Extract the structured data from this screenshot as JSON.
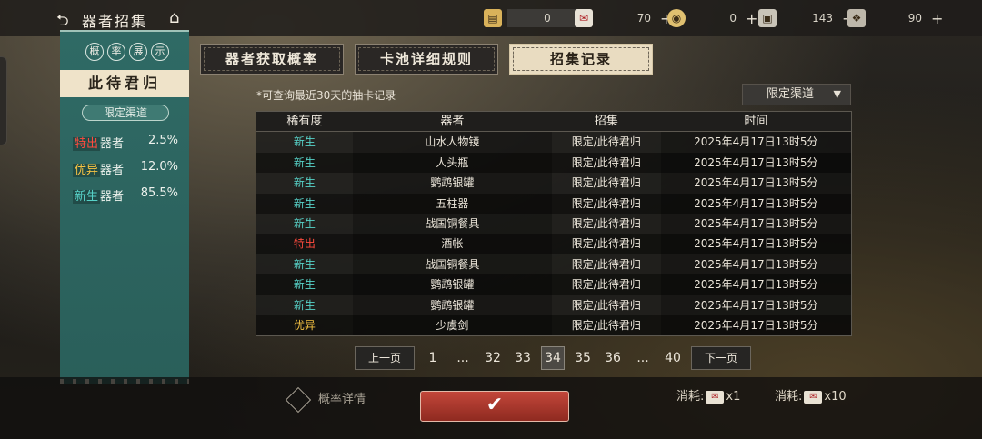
{
  "header": {
    "back_icon": "back-arrow-icon",
    "title": "器者招集",
    "home_icon": "home-icon"
  },
  "resources": [
    {
      "icon": "scroll-icon",
      "value": "0",
      "color": "#d9b25a"
    },
    {
      "icon": "envelope-icon",
      "value": "70",
      "color": "#e8e2d6"
    },
    {
      "icon": "coin-icon",
      "value": "0",
      "color": "#e0c070"
    },
    {
      "icon": "token-icon",
      "value": "143",
      "color": "#c9c4b8"
    },
    {
      "icon": "pattern-icon",
      "value": "90",
      "color": "#bdb7aa"
    }
  ],
  "prob_panel": {
    "tags": [
      "概",
      "率",
      "展",
      "示"
    ],
    "pool_name": "此待君归",
    "channel": "限定渠道",
    "rates": [
      {
        "rarity": "特出",
        "label": "器者",
        "value": "2.5%"
      },
      {
        "rarity": "优异",
        "label": "器者",
        "value": "12.0%"
      },
      {
        "rarity": "新生",
        "label": "器者",
        "value": "85.5%"
      }
    ]
  },
  "tabs": [
    {
      "label": "器者获取概率",
      "active": false
    },
    {
      "label": "卡池详细规则",
      "active": false
    },
    {
      "label": "招集记录",
      "active": true
    }
  ],
  "notice": "*可查询最近30天的抽卡记录",
  "channel_filter": "限定渠道",
  "table": {
    "headers": [
      "稀有度",
      "器者",
      "招集",
      "时间"
    ],
    "rows": [
      {
        "rarity": "新生",
        "name": "山水人物镜",
        "pool": "限定/此待君归",
        "time": "2025年4月17日13时5分"
      },
      {
        "rarity": "新生",
        "name": "人头瓶",
        "pool": "限定/此待君归",
        "time": "2025年4月17日13时5分"
      },
      {
        "rarity": "新生",
        "name": "鹦鹉银罐",
        "pool": "限定/此待君归",
        "time": "2025年4月17日13时5分"
      },
      {
        "rarity": "新生",
        "name": "五柱器",
        "pool": "限定/此待君归",
        "time": "2025年4月17日13时5分"
      },
      {
        "rarity": "新生",
        "name": "战国铜餐具",
        "pool": "限定/此待君归",
        "time": "2025年4月17日13时5分"
      },
      {
        "rarity": "特出",
        "name": "酒帐",
        "pool": "限定/此待君归",
        "time": "2025年4月17日13时5分"
      },
      {
        "rarity": "新生",
        "name": "战国铜餐具",
        "pool": "限定/此待君归",
        "time": "2025年4月17日13时5分"
      },
      {
        "rarity": "新生",
        "name": "鹦鹉银罐",
        "pool": "限定/此待君归",
        "time": "2025年4月17日13时5分"
      },
      {
        "rarity": "新生",
        "name": "鹦鹉银罐",
        "pool": "限定/此待君归",
        "time": "2025年4月17日13时5分"
      },
      {
        "rarity": "优异",
        "name": "少虞剑",
        "pool": "限定/此待君归",
        "time": "2025年4月17日13时5分"
      }
    ]
  },
  "pagination": {
    "prev": "上一页",
    "next": "下一页",
    "pages": [
      "1",
      "...",
      "32",
      "33",
      "34",
      "35",
      "36",
      "...",
      "40"
    ],
    "current": "34"
  },
  "bottom": {
    "prob_detail": "概率详情",
    "confirm_icon": "checkmark-icon",
    "cost_label_1": "消耗:",
    "cost_qty_1": "x1",
    "cost_label_2": "消耗:",
    "cost_qty_2": "x10"
  },
  "rarity_colors": {
    "特出": "#ff4b3e",
    "优异": "#f6c343",
    "新生": "#57d2c8"
  }
}
